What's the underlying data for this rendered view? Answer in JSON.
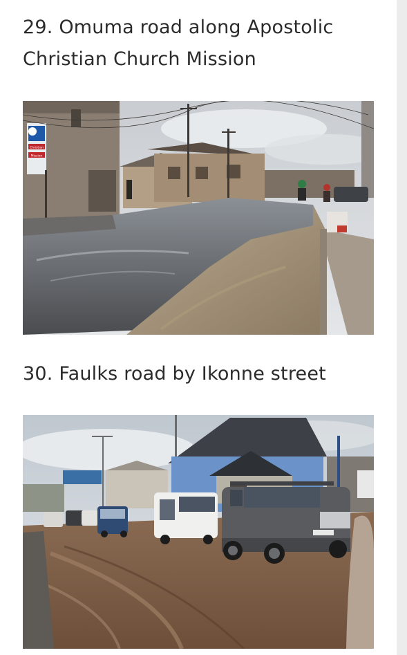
{
  "sections": [
    {
      "heading": "29. Omuma road along Apostolic Christian Church Mission",
      "photo": "flooded-street-photo"
    },
    {
      "heading": "30. Faulks road by Ikonne street",
      "photo": "muddy-road-traffic-photo"
    }
  ],
  "photo1_sign": [
    "Christian",
    "Mission"
  ]
}
